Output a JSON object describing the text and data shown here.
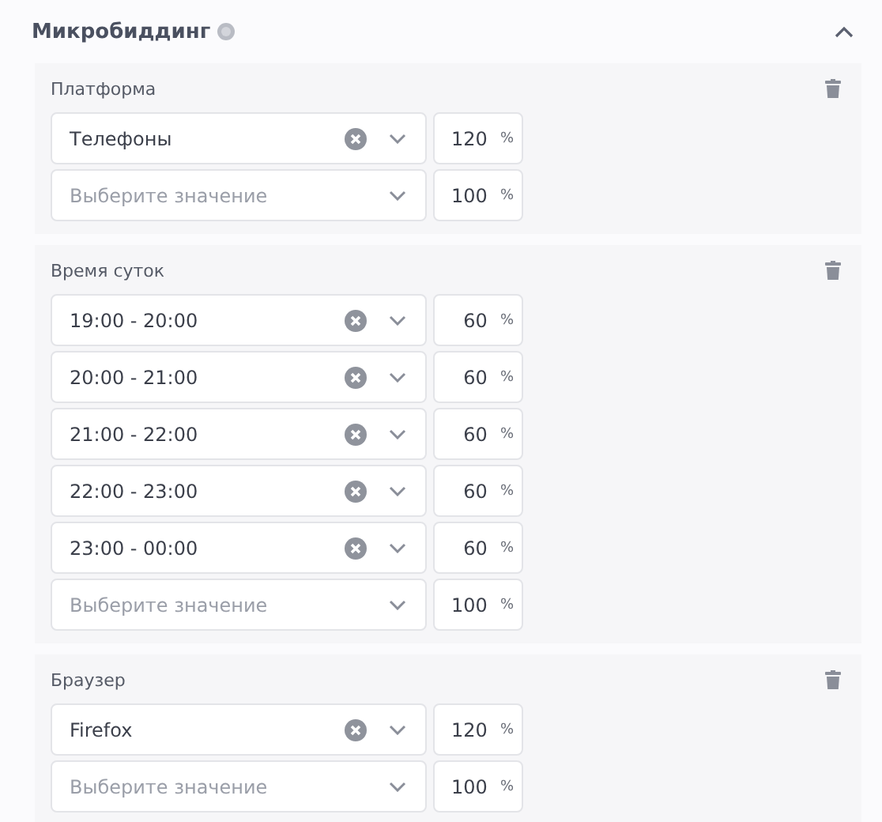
{
  "section": {
    "title": "Микробиддинг",
    "expanded": true
  },
  "groups": [
    {
      "label": "Платформа",
      "rows": [
        {
          "value": "Телефоны",
          "percent": "120",
          "unit": "%"
        },
        {
          "placeholder": "Выберите значение",
          "percent": "100",
          "unit": "%"
        }
      ]
    },
    {
      "label": "Время суток",
      "rows": [
        {
          "value": "19:00 - 20:00",
          "percent": "60",
          "unit": "%"
        },
        {
          "value": "20:00 - 21:00",
          "percent": "60",
          "unit": "%"
        },
        {
          "value": "21:00 - 22:00",
          "percent": "60",
          "unit": "%"
        },
        {
          "value": "22:00 - 23:00",
          "percent": "60",
          "unit": "%"
        },
        {
          "value": "23:00 - 00:00",
          "percent": "60",
          "unit": "%"
        },
        {
          "placeholder": "Выберите значение",
          "percent": "100",
          "unit": "%"
        }
      ]
    },
    {
      "label": "Браузер",
      "rows": [
        {
          "value": "Firefox",
          "percent": "120",
          "unit": "%"
        },
        {
          "placeholder": "Выберите значение",
          "percent": "100",
          "unit": "%"
        }
      ]
    }
  ]
}
